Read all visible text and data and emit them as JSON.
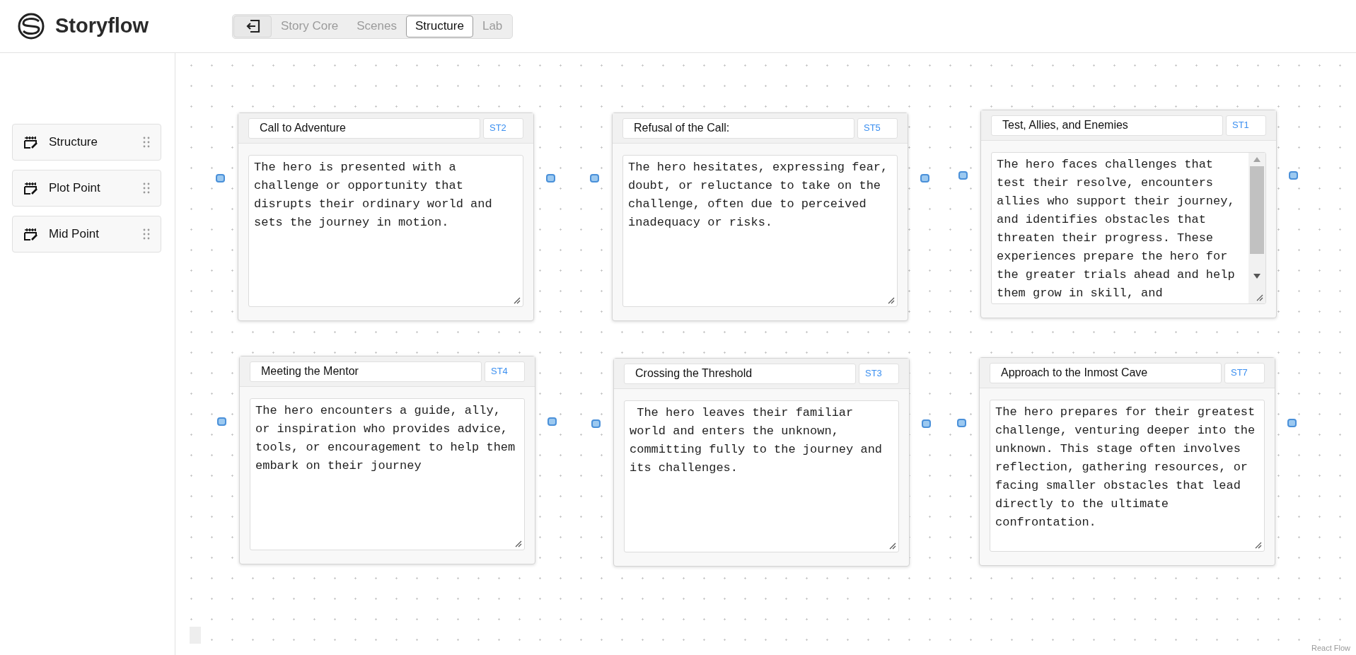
{
  "header": {
    "app_name": "Storyflow",
    "tabs": [
      {
        "label": "Story Core",
        "selected": false
      },
      {
        "label": "Scenes",
        "selected": false
      },
      {
        "label": "Structure",
        "selected": true
      },
      {
        "label": "Lab",
        "selected": false
      }
    ]
  },
  "sidebar": {
    "items": [
      {
        "label": "Structure"
      },
      {
        "label": "Plot Point"
      },
      {
        "label": "Mid Point"
      }
    ]
  },
  "nodes": [
    {
      "title": "Call to Adventure",
      "code": "ST2",
      "text": "The hero is presented with a challenge or opportunity that disrupts their ordinary world and sets the journey in motion.",
      "scrollbar": false
    },
    {
      "title": "Refusal of the Call:",
      "code": "ST5",
      "text": "The hero hesitates, expressing fear, doubt, or reluctance to take on the challenge, often due to perceived inadequacy or risks.",
      "scrollbar": false
    },
    {
      "title": "Test, Allies, and Enemies",
      "code": "ST1",
      "text": "The hero faces challenges that test their resolve, encounters allies who support their journey, and identifies obstacles that threaten their progress. These experiences prepare the hero for the greater trials ahead and help them grow in skill, and",
      "scrollbar": true
    },
    {
      "title": "Meeting the Mentor",
      "code": "ST4",
      "text": "The hero encounters a guide, ally, or inspiration who provides advice, tools, or encouragement to help them embark on their journey",
      "scrollbar": false
    },
    {
      "title": "Crossing the Threshold",
      "code": "ST3",
      "text": " The hero leaves their familiar world and enters the unknown, committing fully to the journey and its challenges.",
      "scrollbar": false
    },
    {
      "title": "Approach to the Inmost Cave",
      "code": "ST7",
      "text": "The hero prepares for their greatest challenge, venturing deeper into the unknown. This stage often involves reflection, gathering resources, or facing smaller obstacles that lead directly to the ultimate confrontation.",
      "scrollbar": false
    }
  ],
  "attribution": "React Flow"
}
